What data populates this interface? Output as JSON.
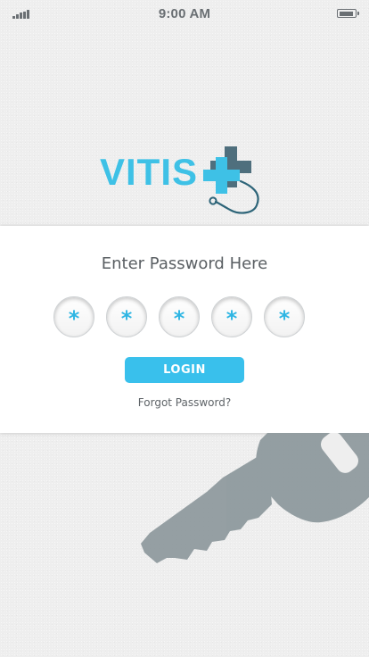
{
  "status_bar": {
    "time": "9:00 AM",
    "signal_icon": "cellular-signal-icon",
    "battery_icon": "battery-icon"
  },
  "logo": {
    "text": "VITIS",
    "mark_icon": "medical-cross-stethoscope-icon"
  },
  "login": {
    "title": "Enter Password Here",
    "pin_digits": [
      "*",
      "*",
      "*",
      "*",
      "*"
    ],
    "button_label": "LOGIN",
    "forgot_label": "Forgot Password?"
  },
  "illustration": {
    "icon": "key-icon"
  },
  "colors": {
    "accent": "#39c0ec",
    "logo_dark": "#4a6a78",
    "key": "#8e9a9e",
    "background": "#eeeeee"
  }
}
